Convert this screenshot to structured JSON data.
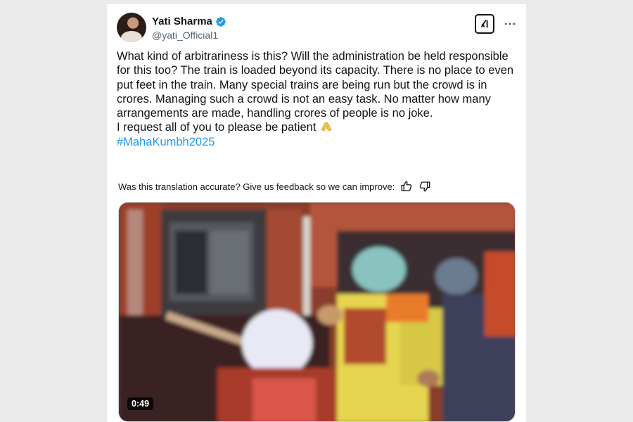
{
  "author": {
    "name": "Yati Sharma",
    "handle": "@yati_Official1",
    "verified": true
  },
  "tweet": {
    "lines": [
      "What kind of arbitrariness is this? Will the administration be held responsible for this too? The train is loaded beyond its capacity. There is no place to even put feet in the train. Many special trains are being run but the crowd is in crores. Managing such a crowd is not an easy task. No matter how many arrangements are made, handling crores of people is no joke.",
      "I request all of you to please be patient"
    ],
    "emoji": "folded-hands-emoji",
    "hashtag": "#MahaKumbh2025"
  },
  "translation_feedback": {
    "prompt": "Was this translation accurate? Give us feedback so we can improve:"
  },
  "video": {
    "duration": "0:49"
  },
  "icons": {
    "verified": "verified-badge-icon",
    "grok": "grok-icon",
    "more": "more-options-icon",
    "thumbs_up": "thumbs-up-icon",
    "thumbs_down": "thumbs-down-icon"
  },
  "colors": {
    "accent": "#1d9bf0",
    "text": "#0f1419",
    "secondary": "#536471"
  }
}
